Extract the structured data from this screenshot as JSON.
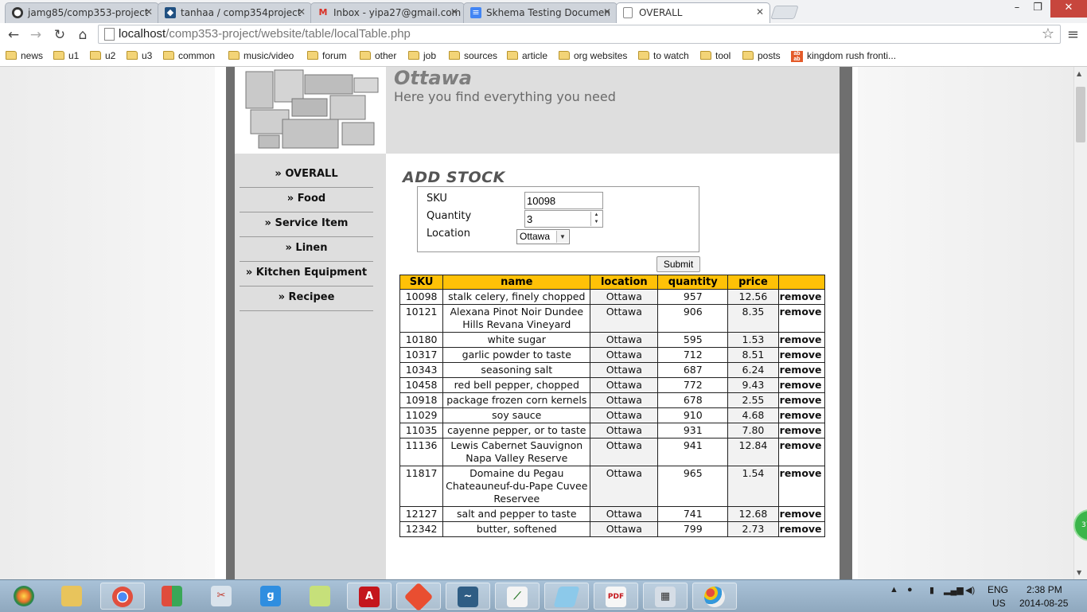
{
  "browser": {
    "tabs": [
      {
        "title": "jamg85/comp353-project",
        "icon": "github-icon"
      },
      {
        "title": "tanhaa / comp354project",
        "icon": "bitbucket-icon"
      },
      {
        "title": "Inbox - yipa27@gmail.com",
        "icon": "gmail-icon"
      },
      {
        "title": "Skhema Testing Documen",
        "icon": "docs-icon"
      },
      {
        "title": "OVERALL",
        "icon": "page-icon",
        "active": true
      }
    ],
    "url_host": "localhost",
    "url_path": "/comp353-project/website/table/localTable.php",
    "bookmarks": [
      "news",
      "u1",
      "u2",
      "u3",
      "common",
      "music/video",
      "forum",
      "other",
      "job",
      "sources",
      "article",
      "org websites",
      "to watch",
      "tool",
      "posts",
      "kingdom rush fronti..."
    ]
  },
  "site": {
    "title": "Ottawa",
    "subtitle": "Here you find everything you need"
  },
  "sidebar": {
    "items": [
      {
        "label": "» OVERALL"
      },
      {
        "label": "» Food"
      },
      {
        "label": "» Service Item"
      },
      {
        "label": "» Linen"
      },
      {
        "label": "» Kitchen Equipment"
      },
      {
        "label": "» Recipee"
      }
    ]
  },
  "form": {
    "heading": "ADD STOCK",
    "sku_label": "SKU",
    "sku_value": "10098",
    "quantity_label": "Quantity",
    "quantity_value": "3",
    "location_label": "Location",
    "location_value": "Ottawa",
    "submit_label": "Submit"
  },
  "table": {
    "headers": [
      "SKU",
      "name",
      "location",
      "quantity",
      "price",
      ""
    ],
    "remove_label": "remove",
    "rows": [
      {
        "sku": "10098",
        "name": "stalk celery, finely chopped",
        "location": "Ottawa",
        "quantity": "957",
        "price": "12.56"
      },
      {
        "sku": "10121",
        "name": "Alexana Pinot Noir Dundee Hills Revana Vineyard",
        "location": "Ottawa",
        "quantity": "906",
        "price": "8.35"
      },
      {
        "sku": "10180",
        "name": "white sugar",
        "location": "Ottawa",
        "quantity": "595",
        "price": "1.53"
      },
      {
        "sku": "10317",
        "name": "garlic powder to taste",
        "location": "Ottawa",
        "quantity": "712",
        "price": "8.51"
      },
      {
        "sku": "10343",
        "name": "seasoning salt",
        "location": "Ottawa",
        "quantity": "687",
        "price": "6.24"
      },
      {
        "sku": "10458",
        "name": "red bell pepper, chopped",
        "location": "Ottawa",
        "quantity": "772",
        "price": "9.43"
      },
      {
        "sku": "10918",
        "name": "package frozen corn kernels",
        "location": "Ottawa",
        "quantity": "678",
        "price": "2.55"
      },
      {
        "sku": "11029",
        "name": "soy sauce",
        "location": "Ottawa",
        "quantity": "910",
        "price": "4.68"
      },
      {
        "sku": "11035",
        "name": "cayenne pepper, or to taste",
        "location": "Ottawa",
        "quantity": "931",
        "price": "7.80"
      },
      {
        "sku": "11136",
        "name": "Lewis Cabernet Sauvignon Napa Valley Reserve",
        "location": "Ottawa",
        "quantity": "941",
        "price": "12.84"
      },
      {
        "sku": "11817",
        "name": "Domaine du Pegau Chateauneuf-du-Pape Cuvee Reservee",
        "location": "Ottawa",
        "quantity": "965",
        "price": "1.54"
      },
      {
        "sku": "12127",
        "name": "salt and pepper to taste",
        "location": "Ottawa",
        "quantity": "741",
        "price": "12.68"
      },
      {
        "sku": "12342",
        "name": "butter, softened",
        "location": "Ottawa",
        "quantity": "799",
        "price": "2.73"
      }
    ]
  },
  "taskbar": {
    "lang": "ENG",
    "region": "US",
    "time": "2:38 PM",
    "date": "2014-08-25",
    "badge": "37"
  },
  "colors": {
    "table_header": "#ffc107",
    "sidebar_bg": "#dedede",
    "frame": "#6f6f6f"
  }
}
